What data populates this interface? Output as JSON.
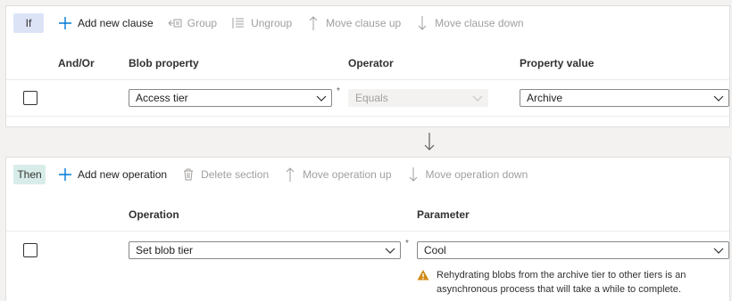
{
  "if_section": {
    "tag": "If",
    "toolbar": {
      "add_clause": "Add new clause",
      "group": "Group",
      "ungroup": "Ungroup",
      "move_up": "Move clause up",
      "move_down": "Move clause down"
    },
    "columns": {
      "andor": "And/Or",
      "blob_property": "Blob property",
      "operator": "Operator",
      "property_value": "Property value"
    },
    "row": {
      "blob_property": "Access tier",
      "operator": "Equals",
      "property_value": "Archive",
      "required_mark": "*"
    }
  },
  "then_section": {
    "tag": "Then",
    "toolbar": {
      "add_operation": "Add new operation",
      "delete_section": "Delete section",
      "move_up": "Move operation up",
      "move_down": "Move operation down"
    },
    "columns": {
      "operation": "Operation",
      "parameter": "Parameter"
    },
    "row": {
      "operation": "Set blob tier",
      "parameter": "Cool",
      "required_mark": "*"
    },
    "warning": {
      "line1": "Rehydrating blobs from the archive tier to other tiers is an",
      "line2": "asynchronous process that will take a while to complete."
    }
  },
  "colors": {
    "if_tag_bg": "#dde3f7",
    "then_tag_bg": "#d8ede9",
    "accent": "#0078d4",
    "warning": "#d18b16",
    "disabled_text": "#a19f9d"
  },
  "icons": {
    "add": "plus-icon",
    "group": "group-icon",
    "ungroup": "ungroup-icon",
    "up": "arrow-up-icon",
    "down": "arrow-down-icon",
    "delete": "trash-icon",
    "warning": "warning-icon",
    "chevron": "chevron-down-icon"
  }
}
